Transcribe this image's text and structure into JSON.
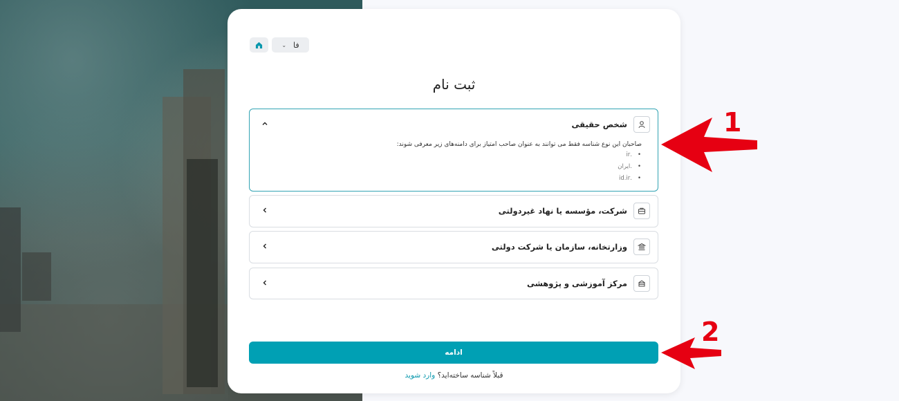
{
  "topbar": {
    "language": "فا",
    "language_chevron": "⌄"
  },
  "page_title": "ثبت نام",
  "options": [
    {
      "title": "شخص حقیقی",
      "icon": "user-icon",
      "expanded": true,
      "description": "صاحبان این نوع شناسه فقط می توانند به عنوان صاحب امتیاز برای دامنه‌های زیر معرفی شوند:",
      "domains": [
        ".ir",
        ".ایران",
        ".id.ir"
      ]
    },
    {
      "title": "شرکت، مؤسسه یا نهاد غیردولتی",
      "icon": "briefcase-icon",
      "expanded": false
    },
    {
      "title": "وزارتخانه، سازمان یا شرکت دولتی",
      "icon": "bank-icon",
      "expanded": false
    },
    {
      "title": "مرکز آموزشی و پژوهشی",
      "icon": "school-icon",
      "expanded": false
    }
  ],
  "continue_label": "ادامه",
  "login_prompt": "قبلاً شناسه ساخته‌اید؟",
  "login_link": "وارد شوید",
  "annotations": [
    "1",
    "2"
  ],
  "colors": {
    "primary": "#00a0b4",
    "accent_border": "#31a3b3",
    "annotation": "#e60012"
  }
}
